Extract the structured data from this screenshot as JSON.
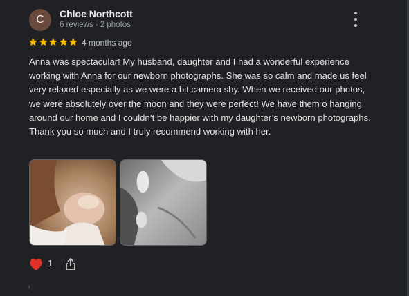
{
  "review": {
    "author": {
      "initial": "C",
      "name": "Chloe Northcott",
      "meta": "6 reviews · 2 photos"
    },
    "rating": 5,
    "rating_color": "#fbbc04",
    "time": "4 months ago",
    "text": "Anna was spectacular! My husband, daughter and I had a wonderful experience working with Anna for our newborn photographs. She was so calm and made us feel very relaxed especially as we were a bit camera shy. When we received our photos, we were absolutely over the moon and they were perfect! We have them o hanging around our home and I couldn’t be happier with my daughter’s newborn photographs. Thank you so much and I truly recommend working with her.",
    "photos": [
      {
        "name": "photo-newborn-color"
      },
      {
        "name": "photo-newborn-bw"
      }
    ],
    "reaction": {
      "icon": "red-heart-icon",
      "count": "1"
    },
    "actions": {
      "share_icon": "share-icon",
      "more_icon": "more-vert-icon"
    }
  }
}
